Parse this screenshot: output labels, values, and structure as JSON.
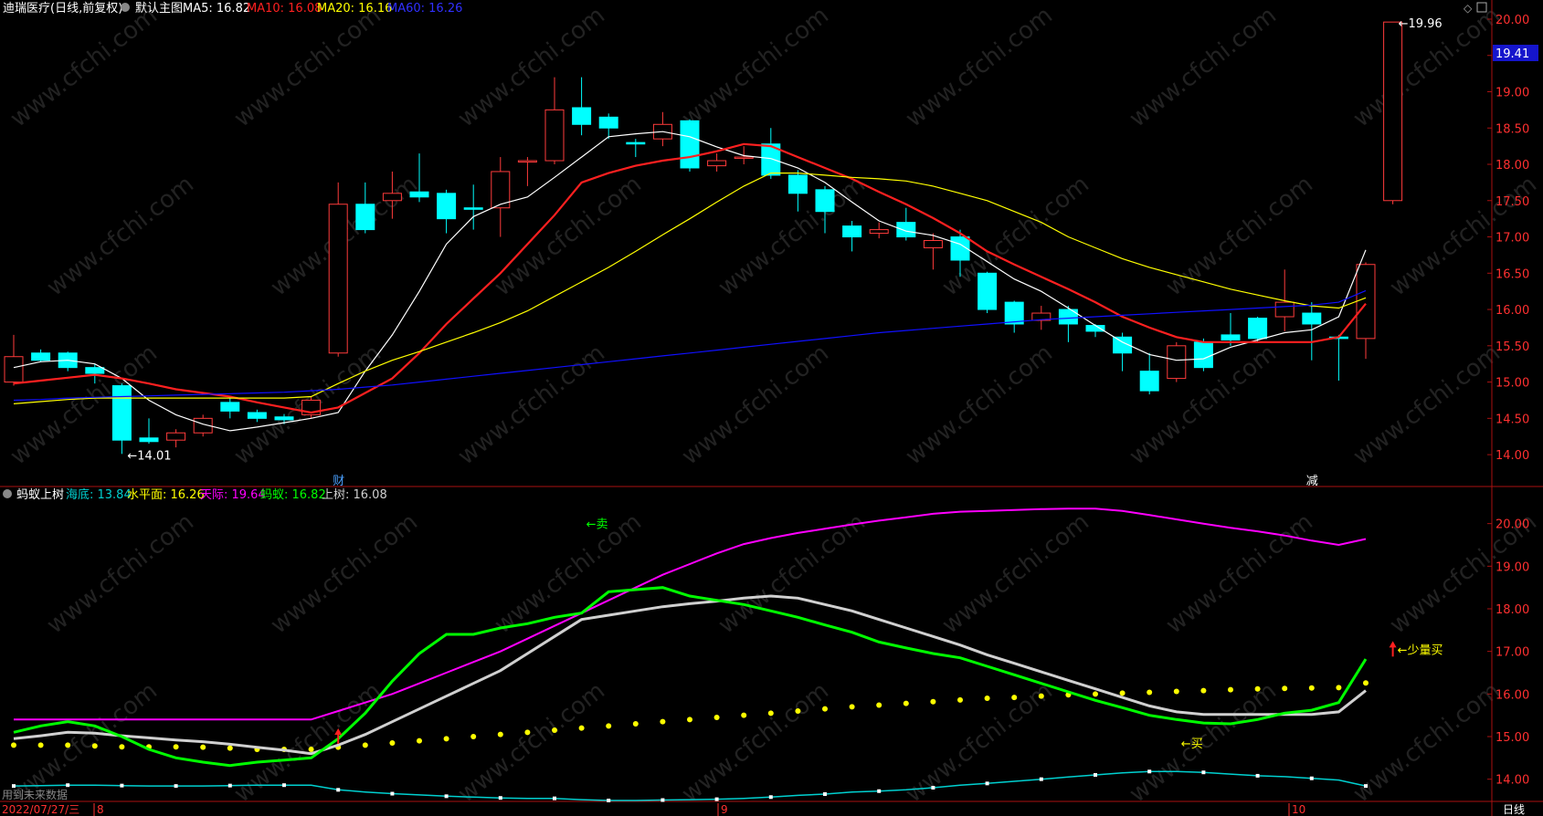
{
  "colors": {
    "background": "#000000",
    "up": "#ff3b3b",
    "down": "#00ffff",
    "axis": "#aa1111",
    "ma5": "#ffffff",
    "ma10": "#ff2020",
    "ma20": "#ffff00",
    "ma60": "#1010ff",
    "haidi": "#00d0d0",
    "shuiping": "#ffff00",
    "tianji": "#ff00ff",
    "mayi": "#00ff00",
    "shangshu": "#d0d0d0"
  },
  "header": {
    "stock": "迪瑞医疗(日线,前复权)",
    "main_label": "默认主图",
    "ma5": "MA5: 16.82",
    "ma10": "MA10: 16.08",
    "ma20": "MA20: 16.16",
    "ma60": "MA60: 16.26"
  },
  "sub_header": {
    "name": "蚂蚁上树",
    "haidi": "海底: 13.84",
    "shuiping": "水平面: 16.26",
    "tianji": "天际: 19.64",
    "mayi": "蚂蚁: 16.82",
    "shangshu": "上树: 16.08"
  },
  "footer": {
    "date": "2022/07/27/三",
    "period": "日线",
    "future_note": "用到未来数据",
    "month_labels": [
      "8",
      "9",
      "10"
    ]
  },
  "watermark": "www.cfchi.com",
  "chart_data": [
    {
      "type": "candlestick",
      "title": "迪瑞医疗(日线,前复权)",
      "ylim": [
        13.8,
        20.05
      ],
      "y_ticks": [
        14.0,
        14.5,
        15.0,
        15.5,
        16.0,
        16.5,
        17.0,
        17.5,
        18.0,
        18.5,
        19.0,
        19.5,
        20.0
      ],
      "y_tick_labels": [
        "14.00",
        "14.50",
        "15.00",
        "15.50",
        "16.00",
        "16.50",
        "17.00",
        "17.50",
        "18.00",
        "18.50",
        "19.00",
        "19.50",
        "20.00"
      ],
      "current_price": "19.41",
      "annotations": [
        {
          "text": "14.01",
          "x": 4
        },
        {
          "text": "19.96",
          "x": 51
        }
      ],
      "event_labels": [
        {
          "text": "财",
          "x": 12
        },
        {
          "text": "减",
          "x": 48
        }
      ],
      "candles": [
        [
          15.0,
          15.35,
          15.65,
          14.95
        ],
        [
          15.4,
          15.3,
          15.45,
          15.28
        ],
        [
          15.4,
          15.2,
          15.42,
          15.15
        ],
        [
          15.2,
          15.12,
          15.25,
          14.98
        ],
        [
          14.95,
          14.2,
          14.98,
          14.01
        ],
        [
          14.23,
          14.18,
          14.5,
          14.15
        ],
        [
          14.2,
          14.3,
          14.35,
          14.1
        ],
        [
          14.3,
          14.5,
          14.55,
          14.25
        ],
        [
          14.72,
          14.6,
          14.8,
          14.5
        ],
        [
          14.58,
          14.5,
          14.62,
          14.45
        ],
        [
          14.52,
          14.48,
          14.56,
          14.42
        ],
        [
          14.55,
          14.75,
          14.8,
          14.5
        ],
        [
          15.4,
          17.45,
          17.75,
          15.35
        ],
        [
          17.45,
          17.1,
          17.75,
          17.05
        ],
        [
          17.5,
          17.6,
          17.9,
          17.25
        ],
        [
          17.62,
          17.55,
          18.15,
          17.48
        ],
        [
          17.6,
          17.25,
          17.65,
          17.05
        ],
        [
          17.4,
          17.38,
          17.72,
          17.1
        ],
        [
          17.4,
          17.9,
          18.1,
          17.0
        ],
        [
          18.05,
          18.05,
          18.1,
          17.7
        ],
        [
          18.05,
          18.75,
          19.2,
          18.0
        ],
        [
          18.78,
          18.55,
          19.2,
          18.4
        ],
        [
          18.65,
          18.5,
          18.7,
          18.35
        ],
        [
          18.3,
          18.28,
          18.35,
          18.1
        ],
        [
          18.35,
          18.55,
          18.72,
          18.25
        ],
        [
          18.6,
          17.95,
          18.62,
          17.9
        ],
        [
          17.98,
          18.05,
          18.15,
          17.9
        ],
        [
          18.1,
          18.1,
          18.25,
          18.0
        ],
        [
          18.28,
          17.85,
          18.5,
          17.8
        ],
        [
          17.85,
          17.6,
          17.92,
          17.35
        ],
        [
          17.65,
          17.35,
          17.7,
          17.05
        ],
        [
          17.15,
          17.0,
          17.22,
          16.8
        ],
        [
          17.05,
          17.1,
          17.2,
          16.98
        ],
        [
          17.2,
          17.0,
          17.4,
          16.95
        ],
        [
          16.85,
          16.95,
          17.05,
          16.55
        ],
        [
          17.0,
          16.68,
          17.1,
          16.45
        ],
        [
          16.5,
          16.0,
          16.52,
          15.95
        ],
        [
          16.1,
          15.8,
          16.12,
          15.68
        ],
        [
          15.85,
          15.95,
          16.05,
          15.72
        ],
        [
          16.0,
          15.8,
          16.05,
          15.55
        ],
        [
          15.78,
          15.7,
          15.8,
          15.62
        ],
        [
          15.62,
          15.4,
          15.68,
          15.15
        ],
        [
          15.15,
          14.88,
          15.4,
          14.83
        ],
        [
          15.05,
          15.5,
          15.55,
          15.0
        ],
        [
          15.55,
          15.2,
          15.6,
          15.15
        ],
        [
          15.65,
          15.58,
          15.95,
          15.5
        ],
        [
          15.88,
          15.6,
          15.9,
          15.55
        ],
        [
          15.9,
          16.1,
          16.55,
          15.7
        ],
        [
          15.95,
          15.8,
          16.1,
          15.3
        ],
        [
          15.62,
          15.6,
          15.65,
          15.02
        ],
        [
          15.6,
          16.62,
          16.65,
          15.32
        ],
        [
          17.5,
          19.96,
          19.96,
          17.45
        ]
      ],
      "series": [
        {
          "name": "MA5",
          "values": [
            15.2,
            15.28,
            15.3,
            15.25,
            15.05,
            14.75,
            14.55,
            14.42,
            14.33,
            14.38,
            14.44,
            14.5,
            14.58,
            15.15,
            15.65,
            16.25,
            16.9,
            17.28,
            17.45,
            17.55,
            17.82,
            18.1,
            18.38,
            18.42,
            18.45,
            18.38,
            18.24,
            18.12,
            18.08,
            17.95,
            17.75,
            17.48,
            17.22,
            17.08,
            17.02,
            16.9,
            16.66,
            16.42,
            16.25,
            16.02,
            15.78,
            15.55,
            15.38,
            15.3,
            15.32,
            15.48,
            15.58,
            15.68,
            15.72,
            15.9,
            16.82
          ]
        },
        {
          "name": "MA10",
          "values": [
            14.98,
            15.02,
            15.06,
            15.1,
            15.05,
            14.98,
            14.9,
            14.85,
            14.8,
            14.72,
            14.65,
            14.58,
            14.65,
            14.85,
            15.05,
            15.4,
            15.8,
            16.15,
            16.5,
            16.9,
            17.3,
            17.75,
            17.88,
            17.98,
            18.05,
            18.1,
            18.18,
            18.28,
            18.25,
            18.1,
            17.95,
            17.8,
            17.62,
            17.45,
            17.26,
            17.05,
            16.8,
            16.62,
            16.45,
            16.28,
            16.1,
            15.9,
            15.75,
            15.62,
            15.55,
            15.55,
            15.55,
            15.55,
            15.55,
            15.62,
            16.08
          ]
        },
        {
          "name": "MA20",
          "values": [
            14.7,
            14.73,
            14.76,
            14.78,
            14.78,
            14.78,
            14.78,
            14.78,
            14.78,
            14.78,
            14.78,
            14.8,
            14.98,
            15.15,
            15.3,
            15.42,
            15.55,
            15.68,
            15.82,
            15.98,
            16.18,
            16.38,
            16.58,
            16.8,
            17.03,
            17.25,
            17.48,
            17.7,
            17.88,
            17.88,
            17.85,
            17.82,
            17.8,
            17.77,
            17.7,
            17.6,
            17.5,
            17.35,
            17.2,
            17.0,
            16.85,
            16.7,
            16.58,
            16.48,
            16.38,
            16.28,
            16.2,
            16.12,
            16.05,
            16.02,
            16.16
          ]
        },
        {
          "name": "MA60",
          "values": [
            14.75,
            14.76,
            14.78,
            14.79,
            14.8,
            14.81,
            14.82,
            14.83,
            14.84,
            14.85,
            14.86,
            14.88,
            14.9,
            14.93,
            14.96,
            15.0,
            15.04,
            15.08,
            15.12,
            15.16,
            15.2,
            15.24,
            15.28,
            15.32,
            15.36,
            15.4,
            15.44,
            15.48,
            15.52,
            15.56,
            15.6,
            15.64,
            15.68,
            15.71,
            15.74,
            15.77,
            15.8,
            15.83,
            15.86,
            15.88,
            15.9,
            15.92,
            15.94,
            15.96,
            15.98,
            16.0,
            16.02,
            16.04,
            16.06,
            16.1,
            16.26
          ]
        }
      ]
    },
    {
      "type": "line",
      "title": "蚂蚁上树",
      "ylim": [
        13.5,
        20.7
      ],
      "y_ticks": [
        14.0,
        15.0,
        16.0,
        17.0,
        18.0,
        19.0,
        20.0
      ],
      "y_tick_labels": [
        "14.00",
        "15.00",
        "16.00",
        "17.00",
        "18.00",
        "19.00",
        "20.00"
      ],
      "annotations": [
        {
          "text": "←卖",
          "x": 21,
          "y": 20.0
        },
        {
          "text": "←买",
          "x": 43,
          "y": 14.85
        },
        {
          "text": "←少量买",
          "x": 51,
          "y": 17.05
        }
      ],
      "arrows": [
        {
          "x": 12,
          "y": 15.0
        },
        {
          "x": 51,
          "y": 17.05
        }
      ],
      "series": [
        {
          "name": "海底",
          "style": "line-markers",
          "values": [
            13.84,
            13.85,
            13.86,
            13.86,
            13.85,
            13.84,
            13.84,
            13.84,
            13.85,
            13.86,
            13.86,
            13.86,
            13.75,
            13.7,
            13.66,
            13.63,
            13.6,
            13.58,
            13.56,
            13.55,
            13.55,
            13.52,
            13.5,
            13.5,
            13.51,
            13.52,
            13.53,
            13.55,
            13.58,
            13.62,
            13.65,
            13.7,
            13.72,
            13.75,
            13.8,
            13.86,
            13.9,
            13.95,
            14.0,
            14.05,
            14.1,
            14.15,
            14.18,
            14.18,
            14.16,
            14.12,
            14.08,
            14.06,
            14.02,
            13.98,
            13.84
          ]
        },
        {
          "name": "水平面",
          "style": "dots",
          "values": [
            14.8,
            14.8,
            14.8,
            14.78,
            14.76,
            14.76,
            14.76,
            14.75,
            14.73,
            14.7,
            14.7,
            14.7,
            14.75,
            14.8,
            14.85,
            14.9,
            14.95,
            15.0,
            15.05,
            15.1,
            15.15,
            15.2,
            15.25,
            15.3,
            15.35,
            15.4,
            15.45,
            15.5,
            15.55,
            15.6,
            15.65,
            15.7,
            15.74,
            15.78,
            15.82,
            15.86,
            15.9,
            15.92,
            15.95,
            15.98,
            16.0,
            16.02,
            16.04,
            16.06,
            16.08,
            16.1,
            16.12,
            16.13,
            16.14,
            16.15,
            16.26
          ]
        },
        {
          "name": "天际",
          "values": [
            15.4,
            15.4,
            15.4,
            15.4,
            15.4,
            15.4,
            15.4,
            15.4,
            15.4,
            15.4,
            15.4,
            15.4,
            15.6,
            15.8,
            16.0,
            16.25,
            16.5,
            16.75,
            17.0,
            17.3,
            17.6,
            17.9,
            18.2,
            18.5,
            18.8,
            19.05,
            19.3,
            19.52,
            19.66,
            19.78,
            19.88,
            19.98,
            20.07,
            20.15,
            20.23,
            20.28,
            20.3,
            20.32,
            20.34,
            20.35,
            20.35,
            20.3,
            20.2,
            20.1,
            20.0,
            19.9,
            19.82,
            19.72,
            19.6,
            19.5,
            19.64
          ]
        },
        {
          "name": "蚂蚁",
          "values": [
            15.1,
            15.25,
            15.35,
            15.25,
            15.0,
            14.7,
            14.5,
            14.4,
            14.32,
            14.4,
            14.45,
            14.5,
            14.95,
            15.55,
            16.3,
            16.95,
            17.4,
            17.4,
            17.55,
            17.65,
            17.8,
            17.9,
            18.4,
            18.45,
            18.5,
            18.3,
            18.2,
            18.1,
            17.95,
            17.8,
            17.62,
            17.45,
            17.22,
            17.08,
            16.95,
            16.85,
            16.65,
            16.45,
            16.25,
            16.05,
            15.85,
            15.68,
            15.5,
            15.4,
            15.32,
            15.3,
            15.4,
            15.55,
            15.62,
            15.8,
            16.82
          ]
        },
        {
          "name": "上树",
          "values": [
            14.95,
            15.02,
            15.1,
            15.08,
            15.02,
            14.97,
            14.92,
            14.88,
            14.82,
            14.75,
            14.68,
            14.6,
            14.8,
            15.05,
            15.35,
            15.65,
            15.95,
            16.25,
            16.55,
            16.95,
            17.35,
            17.75,
            17.85,
            17.95,
            18.05,
            18.12,
            18.18,
            18.25,
            18.3,
            18.25,
            18.1,
            17.95,
            17.75,
            17.55,
            17.35,
            17.15,
            16.92,
            16.72,
            16.52,
            16.32,
            16.12,
            15.92,
            15.72,
            15.58,
            15.52,
            15.52,
            15.52,
            15.52,
            15.52,
            15.58,
            16.08
          ]
        }
      ]
    }
  ]
}
